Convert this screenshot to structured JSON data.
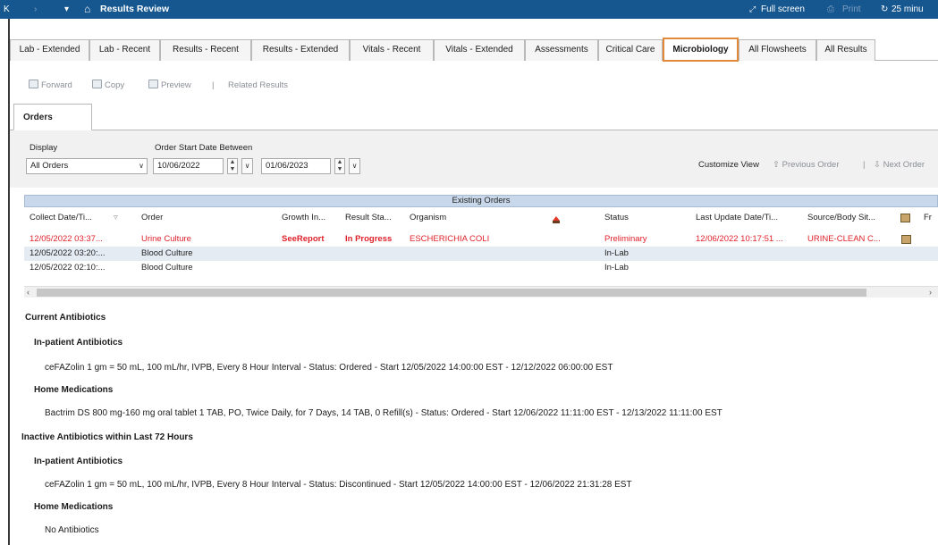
{
  "titlebar": {
    "nav_back": "K",
    "nav_forward": "›",
    "nav_dropdown": "▾",
    "title": "Results Review",
    "full_screen": "Full screen",
    "print": "Print",
    "refresh": "25 minu"
  },
  "tabs": [
    {
      "label": "Lab - Extended"
    },
    {
      "label": "Lab - Recent"
    },
    {
      "label": "Results - Recent"
    },
    {
      "label": "Results - Extended"
    },
    {
      "label": "Vitals - Recent"
    },
    {
      "label": "Vitals - Extended"
    },
    {
      "label": "Assessments"
    },
    {
      "label": "Critical Care"
    },
    {
      "label": "Microbiology"
    },
    {
      "label": "All Flowsheets"
    },
    {
      "label": "All Results"
    }
  ],
  "toolbar": {
    "forward": "Forward",
    "copy": "Copy",
    "preview": "Preview",
    "separator": "|",
    "related": "Related Results"
  },
  "orders_tab": "Orders",
  "filters": {
    "display_label": "Display",
    "display_value": "All Orders",
    "date_label": "Order Start Date Between",
    "start_date": "10/06/2022",
    "end_date": "01/06/2023",
    "customize": "Customize View",
    "prev_order": "Previous Order",
    "separator": "|",
    "next_order": "Next Order"
  },
  "grid": {
    "group_title": "Existing Orders",
    "columns": [
      "Collect Date/Ti...",
      "Order",
      "Growth In...",
      "Result Sta...",
      "Organism",
      "Status",
      "Last Update Date/Ti...",
      "Source/Body Sit...",
      "Fr"
    ],
    "rows": [
      {
        "collect": "12/05/2022 03:37...",
        "order": "Urine Culture",
        "growth": "SeeReport",
        "result_status": "In Progress",
        "organism": "ESCHERICHIA COLI",
        "status": "Preliminary",
        "last_update": "12/06/2022 10:17:51 ...",
        "source": "URINE-CLEAN C..."
      },
      {
        "collect": "12/05/2022 03:20:...",
        "order": "Blood Culture",
        "growth": "",
        "result_status": "",
        "organism": "",
        "status": "In-Lab",
        "last_update": "",
        "source": ""
      },
      {
        "collect": "12/05/2022 02:10:...",
        "order": "Blood Culture",
        "growth": "",
        "result_status": "",
        "organism": "",
        "status": "In-Lab",
        "last_update": "",
        "source": ""
      }
    ]
  },
  "antibiotics": {
    "current_title": "Current Antibiotics",
    "current_inpatient_title": "In-patient Antibiotics",
    "current_inpatient_text": "ceFAZolin 1 gm = 50 mL, 100 mL/hr, IVPB, Every 8 Hour Interval - Status: Ordered - Start 12/05/2022 14:00:00 EST - 12/12/2022 06:00:00 EST",
    "current_home_title": "Home Medications",
    "current_home_text": "Bactrim DS 800 mg-160 mg oral tablet 1 TAB, PO, Twice Daily, for 7 Days, 14 TAB, 0 Refill(s) - Status: Ordered - Start 12/06/2022 11:11:00 EST - 12/13/2022 11:11:00 EST",
    "inactive_title": "Inactive Antibiotics within Last 72 Hours",
    "inactive_inpatient_title": "In-patient Antibiotics",
    "inactive_inpatient_text": "ceFAZolin 1 gm = 50 mL, 100 mL/hr, IVPB, Every 8 Hour Interval - Status: Discontinued - Start 12/05/2022 14:00:00 EST - 12/06/2022 21:31:28 EST",
    "inactive_home_title": "Home Medications",
    "inactive_home_text": "No Antibiotics"
  }
}
